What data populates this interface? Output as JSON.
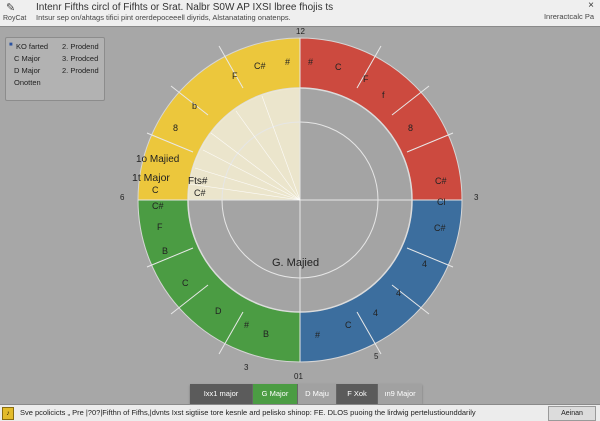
{
  "window": {
    "app_name": "RoyCat",
    "title": "Intenr Fifths circl of Fifhts or Srat. Nalbr S0W AP IXSI lbree fhojis ts",
    "subtitle": "Intsur sep on/ahtags tifici pint orerdepoceeell diyrids, Alstanatating onatenps.",
    "right_label": "Inreractcalc Pa",
    "close_glyph": "×"
  },
  "legend": {
    "col1": [
      "KO farted",
      "C Major",
      "D Major",
      "Onotten"
    ],
    "col2": [
      "2. Prodend",
      "3. Prodced",
      "2. Prodend"
    ]
  },
  "wheel": {
    "outer_labels": {
      "top": "12",
      "left": "6",
      "right": "3",
      "bottom": "01",
      "bottom_left": "3",
      "bottom_right": "5"
    },
    "sectors": {
      "yellow": [
        "C#",
        "#",
        "F",
        "b",
        "8",
        "1o Majied"
      ],
      "red": [
        "#",
        "C",
        "F",
        "f",
        "8",
        "C#"
      ],
      "green": [
        "C#",
        "F",
        "B",
        "C",
        "D",
        "#",
        "B"
      ],
      "blue": [
        "Cl",
        "C#",
        "4",
        "4",
        "4",
        "C",
        "#"
      ]
    },
    "highlight_labels": [
      "1t Major",
      "C",
      "Fts#",
      "C#"
    ],
    "center_label": "G. Majied",
    "colors": {
      "yellow": "#ecc73c",
      "red": "#cc4a3f",
      "green": "#4b9c43",
      "blue": "#3c6e9e"
    }
  },
  "bottom_bar": {
    "buttons": [
      {
        "label": "Ixx1 major",
        "color": "#5b5b5b"
      },
      {
        "label": "G Major",
        "color": "#4b9c43"
      },
      {
        "label": "D Maju",
        "color": "#a1a1a1"
      },
      {
        "label": "F Xok",
        "color": "#5b5b5b"
      },
      {
        "label": "ın9 Major",
        "color": "#a1a1a1"
      }
    ]
  },
  "statusbar": {
    "icon_glyph": "♪",
    "text": "Sve pcolicicts „ Pre |?0?|Fifthn of Fifhs,|dvnts  Ixst sigtiise tore kesnle ard pelisko shinop: FE. DLOS puoing the lirdwig pertelustiounddarily",
    "button": "Aeinan"
  }
}
